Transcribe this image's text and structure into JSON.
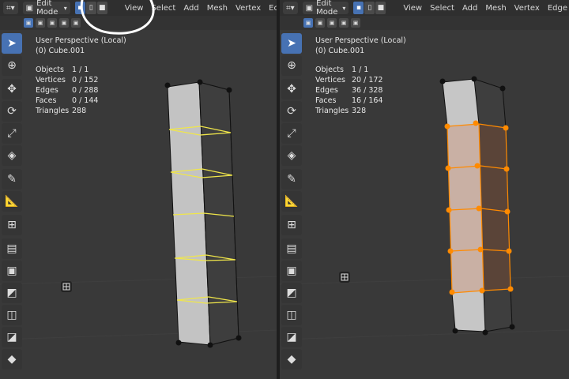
{
  "colors": {
    "viewport": "#393939",
    "header": "#2f2f2f",
    "accent_blue": "#4772b3",
    "edge_select_yellow": "#f0e64a",
    "vertex_orange": "#ff8a00",
    "mesh_face": "#b7b7b7",
    "annotation": "#ffffff"
  },
  "left": {
    "header": {
      "mode": "Edit Mode",
      "menus": [
        "View",
        "Select",
        "Add",
        "Mesh",
        "Vertex",
        "Ec"
      ]
    },
    "overlay": {
      "perspective": "User Perspective (Local)",
      "object": "(0) Cube.001",
      "stats": [
        {
          "label": "Objects",
          "value": "1 / 1"
        },
        {
          "label": "Vertices",
          "value": "0 / 152"
        },
        {
          "label": "Edges",
          "value": "0 / 288"
        },
        {
          "label": "Faces",
          "value": "0 / 144"
        },
        {
          "label": "Triangles",
          "value": "288"
        }
      ]
    }
  },
  "right": {
    "header": {
      "mode": "Edit Mode",
      "menus": [
        "View",
        "Select",
        "Add",
        "Mesh",
        "Vertex",
        "Edge"
      ]
    },
    "overlay": {
      "perspective": "User Perspective (Local)",
      "object": "(0) Cube.001",
      "stats": [
        {
          "label": "Objects",
          "value": "1 / 1"
        },
        {
          "label": "Vertices",
          "value": "20 / 172"
        },
        {
          "label": "Edges",
          "value": "36 / 328"
        },
        {
          "label": "Faces",
          "value": "16 / 164"
        },
        {
          "label": "Triangles",
          "value": "328"
        }
      ]
    }
  },
  "toolbar_icons": [
    "select-box-icon",
    "cursor-icon",
    "move-icon",
    "rotate-icon",
    "scale-icon",
    "transform-icon",
    "annotate-icon",
    "measure-icon",
    "add-cube-icon",
    "extrude-icon",
    "inset-icon",
    "bevel-icon",
    "loop-cut-icon",
    "knife-icon",
    "poly-build-icon"
  ]
}
